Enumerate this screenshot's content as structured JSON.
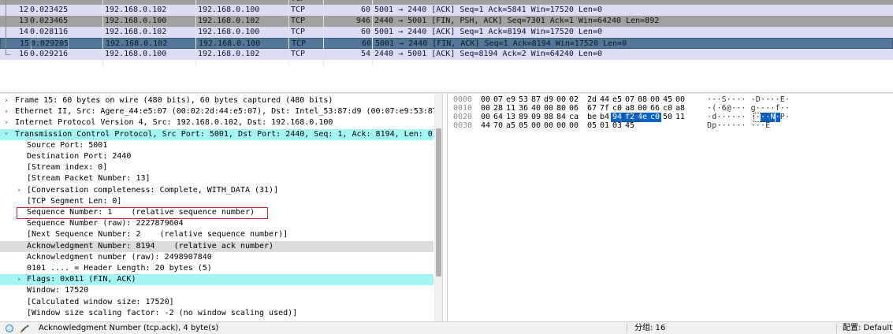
{
  "colors": {
    "ack_row": "#dcdcf5",
    "fin_row": "#a0a0a0",
    "selected_row": "#52789a",
    "cyan_highlight": "#a6f5f5",
    "selection_blue": "#0a64c8",
    "annotation_red": "#d9262e"
  },
  "packets": [
    {
      "no": "",
      "time": "",
      "src": "",
      "dst": "",
      "proto": "TCP",
      "len": "",
      "info": "",
      "style": "fin"
    },
    {
      "no": "12",
      "time": "0.023425",
      "src": "192.168.0.102",
      "dst": "192.168.0.100",
      "proto": "TCP",
      "len": "60",
      "info": "5001 → 2440 [ACK] Seq=1 Ack=5841 Win=17520 Len=0",
      "style": "ack"
    },
    {
      "no": "13",
      "time": "0.023465",
      "src": "192.168.0.100",
      "dst": "192.168.0.102",
      "proto": "TCP",
      "len": "946",
      "info": "2440 → 5001 [FIN, PSH, ACK] Seq=7301 Ack=1 Win=64240 Len=892",
      "style": "fin"
    },
    {
      "no": "14",
      "time": "0.028116",
      "src": "192.168.0.102",
      "dst": "192.168.0.100",
      "proto": "TCP",
      "len": "60",
      "info": "5001 → 2440 [ACK] Seq=1 Ack=8194 Win=17520 Len=0",
      "style": "ack"
    },
    {
      "no": "15",
      "time": "0.029205",
      "src": "192.168.0.102",
      "dst": "192.168.0.100",
      "proto": "TCP",
      "len": "60",
      "info": "5001 → 2440 [FIN, ACK] Seq=1 Ack=8194 Win=17520 Len=0",
      "style": "selected"
    },
    {
      "no": "16",
      "time": "0.029216",
      "src": "192.168.0.100",
      "dst": "192.168.0.102",
      "proto": "TCP",
      "len": "54",
      "info": "2440 → 5001 [ACK] Seq=8194 Ack=2 Win=64240 Len=0",
      "style": "ack"
    }
  ],
  "details": [
    {
      "indent": 0,
      "expander": "collapsed",
      "text": "Frame 15: 60 bytes on wire (480 bits), 60 bytes captured (480 bits)",
      "hl": ""
    },
    {
      "indent": 0,
      "expander": "collapsed",
      "text": "Ethernet II, Src: Agere_44:e5:07 (00:02:2d:44:e5:07), Dst: Intel_53:87:d9 (00:07:e9:53:87:d9)",
      "hl": ""
    },
    {
      "indent": 0,
      "expander": "collapsed",
      "text": "Internet Protocol Version 4, Src: 192.168.0.102, Dst: 192.168.0.100",
      "hl": ""
    },
    {
      "indent": 0,
      "expander": "expanded",
      "text": "Transmission Control Protocol, Src Port: 5001, Dst Port: 2440, Seq: 1, Ack: 8194, Len: 0",
      "hl": "cyan"
    },
    {
      "indent": 1,
      "expander": "",
      "text": "Source Port: 5001",
      "hl": ""
    },
    {
      "indent": 1,
      "expander": "",
      "text": "Destination Port: 2440",
      "hl": ""
    },
    {
      "indent": 1,
      "expander": "",
      "text": "[Stream index: 0]",
      "hl": ""
    },
    {
      "indent": 1,
      "expander": "",
      "text": "[Stream Packet Number: 13]",
      "hl": ""
    },
    {
      "indent": 1,
      "expander": "collapsed",
      "text": "[Conversation completeness: Complete, WITH_DATA (31)]",
      "hl": ""
    },
    {
      "indent": 1,
      "expander": "",
      "text": "[TCP Segment Len: 0]",
      "hl": ""
    },
    {
      "indent": 1,
      "expander": "",
      "text": "Sequence Number: 1    (relative sequence number)",
      "hl": ""
    },
    {
      "indent": 1,
      "expander": "",
      "text": "Sequence Number (raw): 2227879604",
      "hl": ""
    },
    {
      "indent": 1,
      "expander": "",
      "text": "[Next Sequence Number: 2    (relative sequence number)]",
      "hl": ""
    },
    {
      "indent": 1,
      "expander": "",
      "text": "Acknowledgment Number: 8194    (relative ack number)",
      "hl": "grey"
    },
    {
      "indent": 1,
      "expander": "",
      "text": "Acknowledgment number (raw): 2498907840",
      "hl": ""
    },
    {
      "indent": 1,
      "expander": "",
      "text": "0101 .... = Header Length: 20 bytes (5)",
      "hl": ""
    },
    {
      "indent": 1,
      "expander": "collapsed",
      "text": "Flags: 0x011 (FIN, ACK)",
      "hl": "cyan"
    },
    {
      "indent": 1,
      "expander": "",
      "text": "Window: 17520",
      "hl": ""
    },
    {
      "indent": 1,
      "expander": "",
      "text": "[Calculated window size: 17520]",
      "hl": ""
    },
    {
      "indent": 1,
      "expander": "",
      "text": "[Window size scaling factor: -2 (no window scaling used)]",
      "hl": ""
    }
  ],
  "hex_dump": [
    {
      "offset": "0000",
      "bytes": [
        "00",
        "07",
        "e9",
        "53",
        "87",
        "d9",
        "00",
        "02",
        "2d",
        "44",
        "e5",
        "07",
        "08",
        "00",
        "45",
        "00"
      ],
      "ascii": [
        "·",
        "·",
        "·",
        "S",
        "·",
        "·",
        "·",
        "·",
        "-",
        "D",
        "·",
        "·",
        "·",
        "·",
        "E",
        "·"
      ]
    },
    {
      "offset": "0010",
      "bytes": [
        "00",
        "28",
        "11",
        "36",
        "40",
        "00",
        "80",
        "06",
        "67",
        "7f",
        "c0",
        "a8",
        "00",
        "66",
        "c0",
        "a8"
      ],
      "ascii": [
        "·",
        "(",
        "·",
        "6",
        "@",
        "·",
        "·",
        "·",
        "g",
        "·",
        "·",
        "·",
        "·",
        "f",
        "·",
        "·"
      ]
    },
    {
      "offset": "0020",
      "bytes": [
        "00",
        "64",
        "13",
        "89",
        "09",
        "88",
        "84",
        "ca",
        "be",
        "b4",
        "94",
        "f2",
        "4e",
        "c0",
        "50",
        "11"
      ],
      "ascii": [
        "·",
        "d",
        "·",
        "·",
        "·",
        "·",
        "·",
        "·",
        "·",
        "·",
        "·",
        "·",
        "N",
        "·",
        "P",
        "·"
      ]
    },
    {
      "offset": "0030",
      "bytes": [
        "44",
        "70",
        "a5",
        "05",
        "00",
        "00",
        "00",
        "00",
        "05",
        "01",
        "03",
        "45"
      ],
      "ascii": [
        "D",
        "p",
        "·",
        "·",
        "·",
        "·",
        "·",
        "·",
        "·",
        "·",
        "·",
        "E"
      ]
    }
  ],
  "hex_selection": {
    "row": 2,
    "start": 10,
    "end": 13
  },
  "status": {
    "field_info": "Acknowledgment Number (tcp.ack), 4 byte(s)",
    "packets": "分组: 16",
    "profile": "配置: Default"
  },
  "icons": {
    "ready": "ready-status-icon",
    "expert": "expert-info-icon"
  }
}
